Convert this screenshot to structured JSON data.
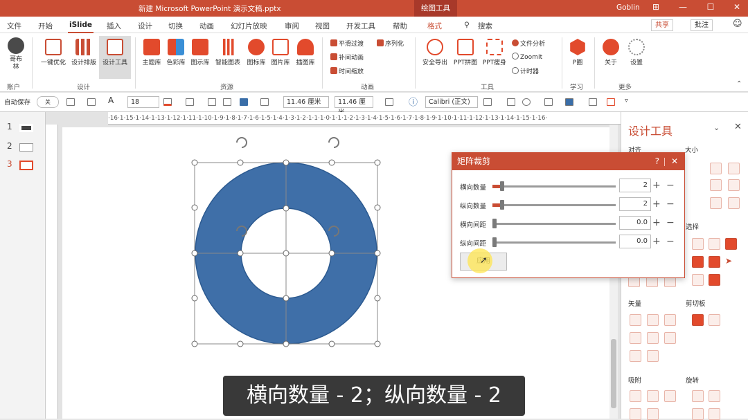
{
  "window": {
    "title": "新建 Microsoft PowerPoint 演示文稿.pptx",
    "context_tab": "绘图工具",
    "user": "Goblin",
    "buttons": [
      "⊞",
      "—",
      "☐",
      "✕"
    ]
  },
  "tabs": [
    {
      "label": "文件"
    },
    {
      "label": "开始"
    },
    {
      "label": "iSlide"
    },
    {
      "label": "插入"
    },
    {
      "label": "设计"
    },
    {
      "label": "切换"
    },
    {
      "label": "动画"
    },
    {
      "label": "幻灯片放映"
    },
    {
      "label": "审阅"
    },
    {
      "label": "视图"
    },
    {
      "label": "开发工具"
    },
    {
      "label": "帮助"
    },
    {
      "label": "格式"
    }
  ],
  "search_label": "搜索",
  "share_label": "共享",
  "comment_label": "批注",
  "ribbon": {
    "account": {
      "btn": "哥布林",
      "group": "账户"
    },
    "design": {
      "items": [
        "一键优化",
        "设计排版",
        "设计工具"
      ],
      "group": "设计"
    },
    "resources": {
      "items": [
        "主题库",
        "色彩库",
        "图示库",
        "智能图表",
        "图标库",
        "图片库",
        "插图库"
      ],
      "group": "资源"
    },
    "animation": {
      "items": [
        "平滑过渡",
        "补间动画",
        "时间缩放",
        "序列化"
      ],
      "group": "动画"
    },
    "tools": {
      "items": [
        "安全导出",
        "PPT拼图",
        "PPT瘦身"
      ],
      "small": [
        "文件分析",
        "ZoomIt",
        "计时器"
      ],
      "group": "工具"
    },
    "learn": {
      "items": [
        "P圈"
      ],
      "group": "学习"
    },
    "more": {
      "items": [
        "关于",
        "设置"
      ],
      "group": "更多"
    }
  },
  "formatbar": {
    "autosave": "自动保存",
    "autosave_state": "关",
    "font_size": "18",
    "width": "11.46 厘米",
    "height": "11.46 厘米",
    "font_name": "Calibri (正文)"
  },
  "slides": [
    {
      "num": "1"
    },
    {
      "num": "2"
    },
    {
      "num": "3"
    }
  ],
  "ruler_text": "·16·1·15·1·14·1·13·1·12·1·11·1·10·1·9·1·8·1·7·1·6·1·5·1·4·1·3·1·2·1·1·1·0·1·1·1·2·1·3·1·4·1·5·1·6·1·7·1·8·1·9·1·10·1·11·1·12·1·13·1·14·1·15·1·16·",
  "dialog": {
    "title": "矩阵裁剪",
    "help": "?",
    "rows": [
      {
        "label": "横向数量",
        "value": "2",
        "fraction": 0.06
      },
      {
        "label": "纵向数量",
        "value": "2",
        "fraction": 0.06
      },
      {
        "label": "横向间距",
        "value": "0.0",
        "fraction": 0.0
      },
      {
        "label": "纵向间距",
        "value": "0.0",
        "fraction": 0.0
      }
    ],
    "apply": "应用"
  },
  "panel": {
    "title": "设计工具",
    "sections": [
      "对齐",
      "大小",
      "选择",
      "矢量",
      "剪切板",
      "吸附",
      "旋转"
    ]
  },
  "subtitle": "横向数量 - 2；纵向数量 - 2",
  "colors": {
    "accent": "#c94d34",
    "shape": "#3f6fa8"
  }
}
